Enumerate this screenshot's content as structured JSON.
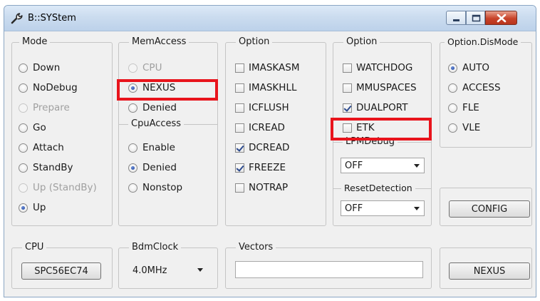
{
  "window": {
    "title": "B::SYStem",
    "icon": "wrench-icon"
  },
  "mode": {
    "title": "Mode",
    "items": [
      {
        "label": "Down",
        "checked": false,
        "disabled": false
      },
      {
        "label": "NoDebug",
        "checked": false,
        "disabled": false
      },
      {
        "label": "Prepare",
        "checked": false,
        "disabled": true
      },
      {
        "label": "Go",
        "checked": false,
        "disabled": false
      },
      {
        "label": "Attach",
        "checked": false,
        "disabled": false
      },
      {
        "label": "StandBy",
        "checked": false,
        "disabled": false
      },
      {
        "label": "Up (StandBy)",
        "checked": false,
        "disabled": true
      },
      {
        "label": "Up",
        "checked": true,
        "disabled": false
      }
    ]
  },
  "memaccess": {
    "title": "MemAccess",
    "items": [
      {
        "label": "CPU",
        "checked": false,
        "disabled": true
      },
      {
        "label": "NEXUS",
        "checked": true,
        "disabled": false
      },
      {
        "label": "Denied",
        "checked": false,
        "disabled": false
      }
    ]
  },
  "cpuaccess": {
    "title": "CpuAccess",
    "items": [
      {
        "label": "Enable",
        "checked": false,
        "disabled": false
      },
      {
        "label": "Denied",
        "checked": true,
        "disabled": false
      },
      {
        "label": "Nonstop",
        "checked": false,
        "disabled": false
      }
    ]
  },
  "option1": {
    "title": "Option",
    "items": [
      {
        "label": "IMASKASM",
        "checked": false
      },
      {
        "label": "IMASKHLL",
        "checked": false
      },
      {
        "label": "ICFLUSH",
        "checked": false
      },
      {
        "label": "ICREAD",
        "checked": false
      },
      {
        "label": "DCREAD",
        "checked": true
      },
      {
        "label": "FREEZE",
        "checked": true
      },
      {
        "label": "NOTRAP",
        "checked": false
      }
    ]
  },
  "option2": {
    "title": "Option",
    "items": [
      {
        "label": "WATCHDOG",
        "checked": false
      },
      {
        "label": "MMUSPACES",
        "checked": false
      },
      {
        "label": "DUALPORT",
        "checked": true
      },
      {
        "label": "ETK",
        "checked": false
      }
    ]
  },
  "lpmdebug": {
    "title": "LPMDebug",
    "value": "OFF"
  },
  "resetdetection": {
    "title": "ResetDetection",
    "value": "OFF"
  },
  "dismode": {
    "title": "Option.DisMode",
    "items": [
      {
        "label": "AUTO",
        "checked": true
      },
      {
        "label": "ACCESS",
        "checked": false
      },
      {
        "label": "FLE",
        "checked": false
      },
      {
        "label": "VLE",
        "checked": false
      }
    ]
  },
  "buttons": {
    "config": "CONFIG",
    "nexus": "NEXUS"
  },
  "cpu": {
    "title": "CPU",
    "value": "SPC56EC74"
  },
  "bdmclock": {
    "title": "BdmClock",
    "value": "4.0MHz"
  },
  "vectors": {
    "title": "Vectors",
    "value": ""
  },
  "highlight_color": "#e8141c"
}
